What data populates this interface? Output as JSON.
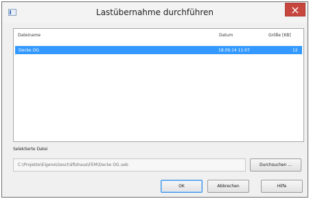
{
  "window": {
    "title": "Lastübernahme durchführen",
    "close_label": "×"
  },
  "table": {
    "headers": {
      "name": "Dateiname",
      "date": "Datum",
      "size": "Größe [KB]"
    },
    "rows": [
      {
        "name": "Decke OG",
        "date": "18.09.14 11:07",
        "size": "12"
      }
    ]
  },
  "selected": {
    "label": "Selektierte Datei",
    "path": "C:\\Projekte\\Eigene\\Geschäftshaus\\FEM\\Decke OG.ueb",
    "browse_label": "Durchsuchen ..."
  },
  "buttons": {
    "ok": "OK",
    "cancel": "Abbrechen",
    "help": "Hilfe"
  }
}
